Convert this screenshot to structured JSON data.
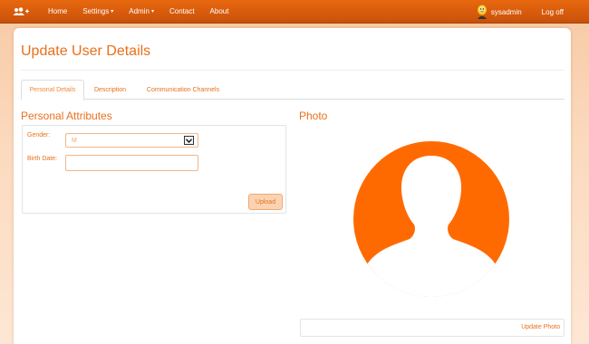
{
  "navbar": {
    "brand_icon": "users-add-icon",
    "items": [
      {
        "label": "Home",
        "dropdown": false
      },
      {
        "label": "Settings",
        "dropdown": true
      },
      {
        "label": "Admin",
        "dropdown": true
      },
      {
        "label": "Contact",
        "dropdown": false
      },
      {
        "label": "About",
        "dropdown": false
      }
    ],
    "user": "sysadmin",
    "logout": "Log off"
  },
  "page": {
    "title": "Update User Details",
    "tabs": [
      {
        "label": "Personal Details",
        "active": true
      },
      {
        "label": "Description",
        "active": false
      },
      {
        "label": "Communication Channels",
        "active": false
      }
    ]
  },
  "personal": {
    "section_title": "Personal Attributes",
    "gender_label": "Gender:",
    "gender_value": "M",
    "birth_label": "Birth Date:",
    "birth_value": "",
    "upload_label": "Upload"
  },
  "photo": {
    "section_title": "Photo",
    "update_label": "Update Photo"
  },
  "colors": {
    "accent": "#e8701a",
    "nav": "#d65c0c",
    "photo": "#ff6a00"
  }
}
